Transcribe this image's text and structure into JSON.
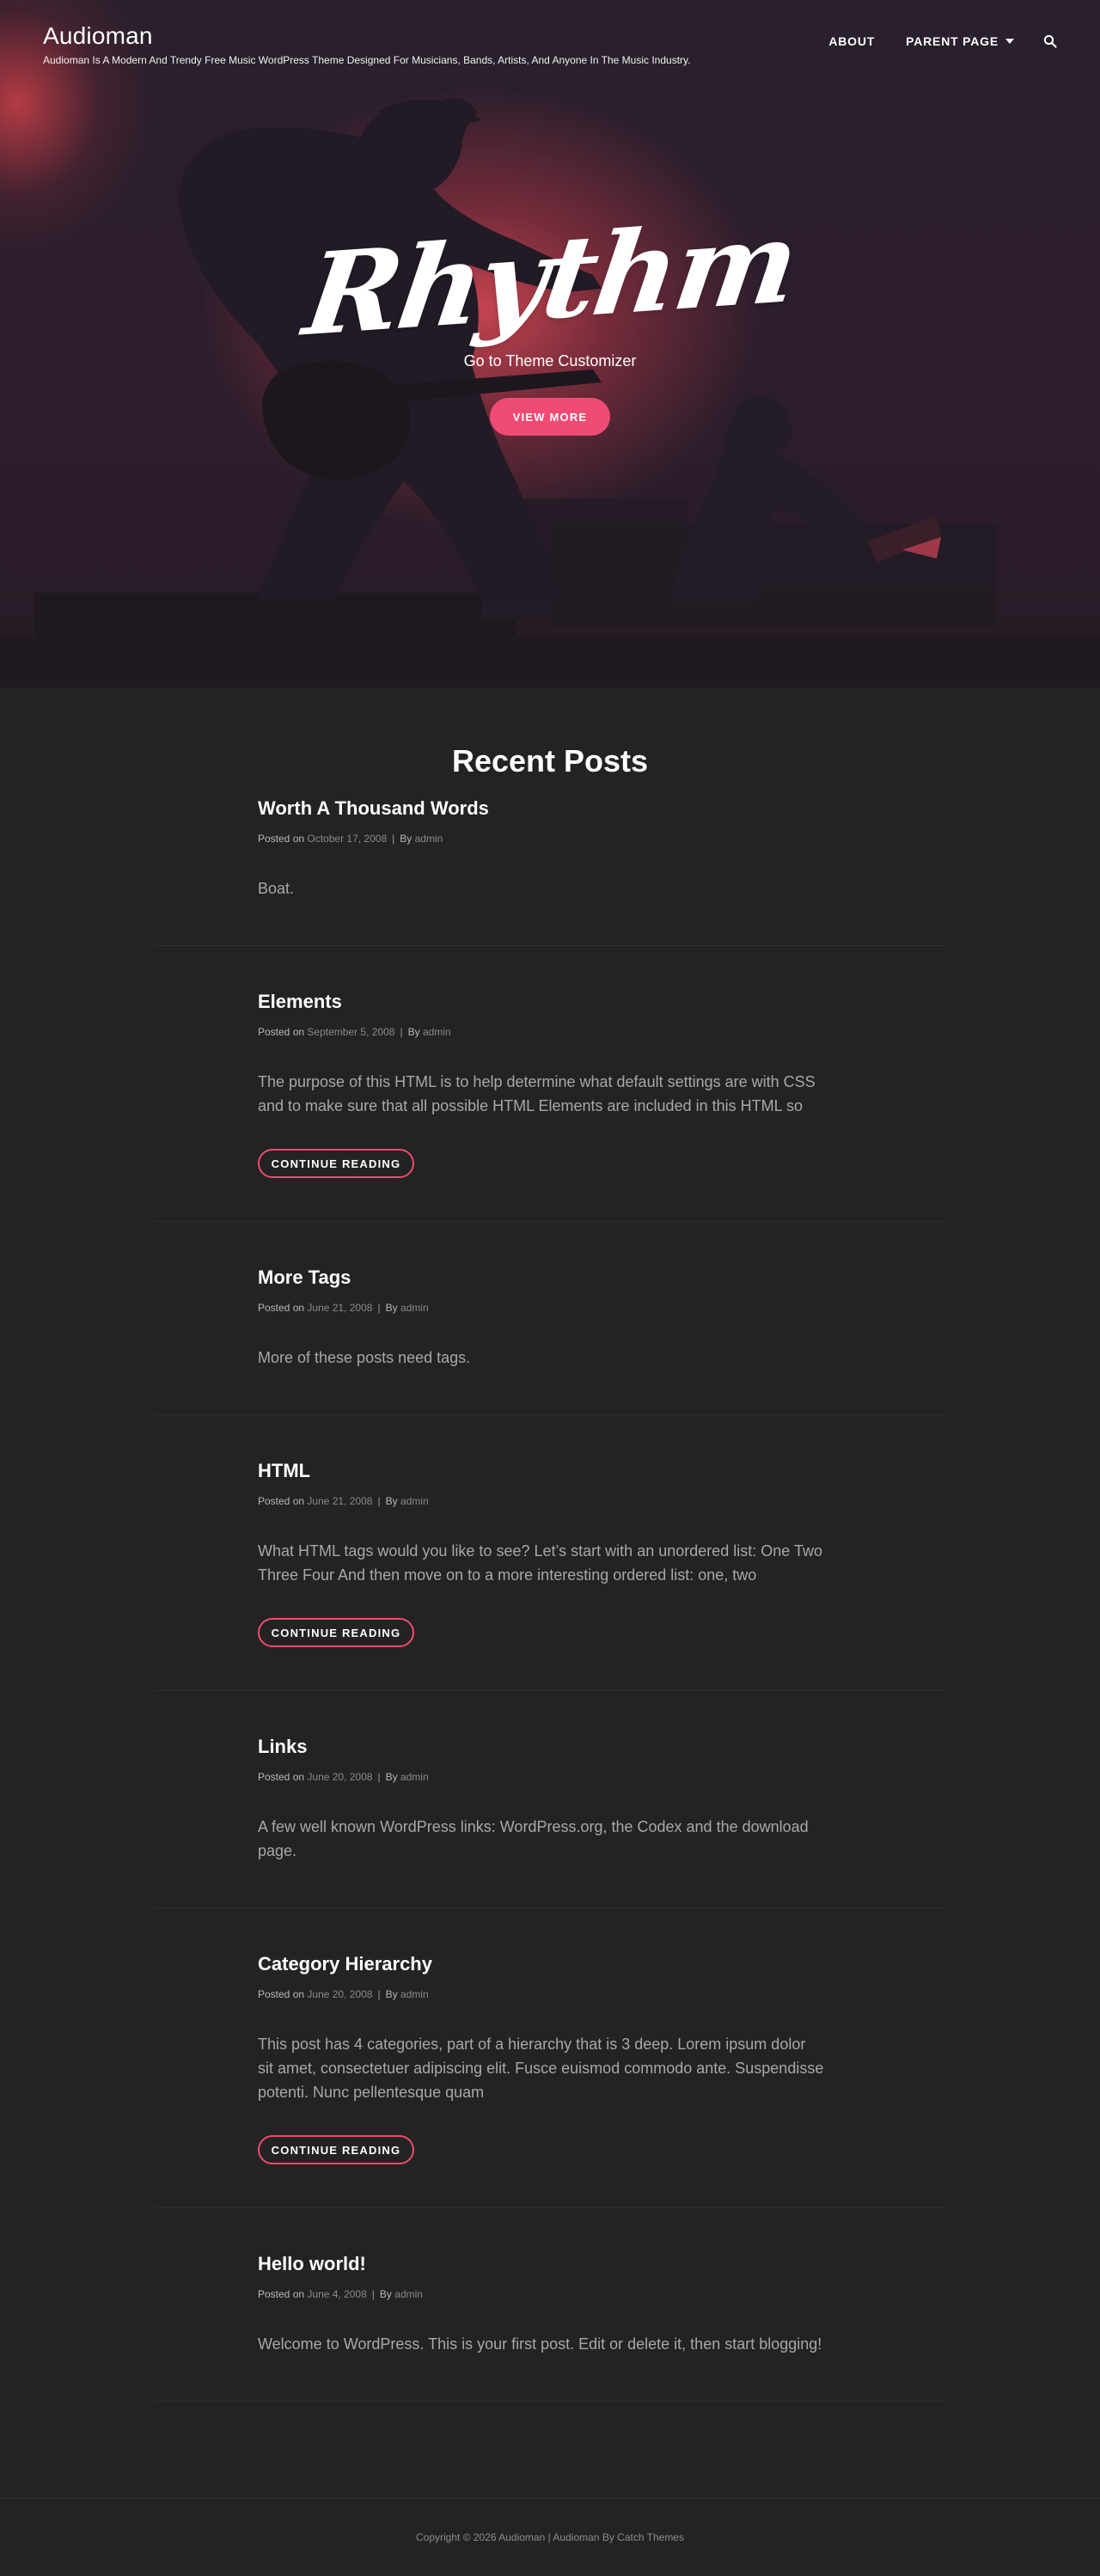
{
  "header": {
    "site_title": "Audioman",
    "tagline": "Audioman Is A Modern And Trendy Free Music WordPress Theme Designed For Musicians, Bands, Artists, And Anyone In The Music Industry.",
    "nav": {
      "about": "About",
      "parent_page": "Parent Page"
    },
    "search_icon": "search-icon"
  },
  "hero": {
    "title": "Rhythm",
    "subtitle": "Go to Theme Customizer",
    "button": "View More"
  },
  "recent_posts": {
    "title": "Recent Posts",
    "meta_posted_on": "Posted on",
    "meta_by": "By",
    "continue_label": "Continue Reading",
    "posts": [
      {
        "title": "Worth A Thousand Words",
        "date": "October 17, 2008",
        "author": "admin",
        "excerpt": "Boat."
      },
      {
        "title": "Elements",
        "date": "September 5, 2008",
        "author": "admin",
        "excerpt": "The purpose of this HTML is to help determine what default settings are with CSS and to make sure that all possible HTML Elements are included in this HTML so"
      },
      {
        "title": "More Tags",
        "date": "June 21, 2008",
        "author": "admin",
        "excerpt": "More of these posts need tags."
      },
      {
        "title": "HTML",
        "date": "June 21, 2008",
        "author": "admin",
        "excerpt": "What HTML tags would you like to see? Let’s start with an unordered list: One Two Three Four And then move on to a more interesting ordered list: one, two"
      },
      {
        "title": "Links",
        "date": "June 20, 2008",
        "author": "admin",
        "excerpt": "A few well known WordPress links: WordPress.org, the Codex and the download page."
      },
      {
        "title": "Category Hierarchy",
        "date": "June 20, 2008",
        "author": "admin",
        "excerpt": "This post has 4 categories, part of a hierarchy that is 3 deep. Lorem ipsum dolor sit amet, consectetuer adipiscing elit. Fusce euismod commodo ante. Suspendisse potenti. Nunc pellentesque quam"
      },
      {
        "title": "Hello world!",
        "date": "June 4, 2008",
        "author": "admin",
        "excerpt": "Welcome to WordPress. This is your first post. Edit or delete it, then start blogging!"
      }
    ]
  },
  "footer": {
    "copyright": "Copyright © 2026",
    "site_link": "Audioman",
    "separator": "|",
    "credit_theme": "Audioman",
    "credit_by": "By",
    "credit_author": "Catch Themes"
  },
  "colors": {
    "accent": "#ef4b74",
    "outline": "#ef4b6b",
    "background": "#232323"
  }
}
